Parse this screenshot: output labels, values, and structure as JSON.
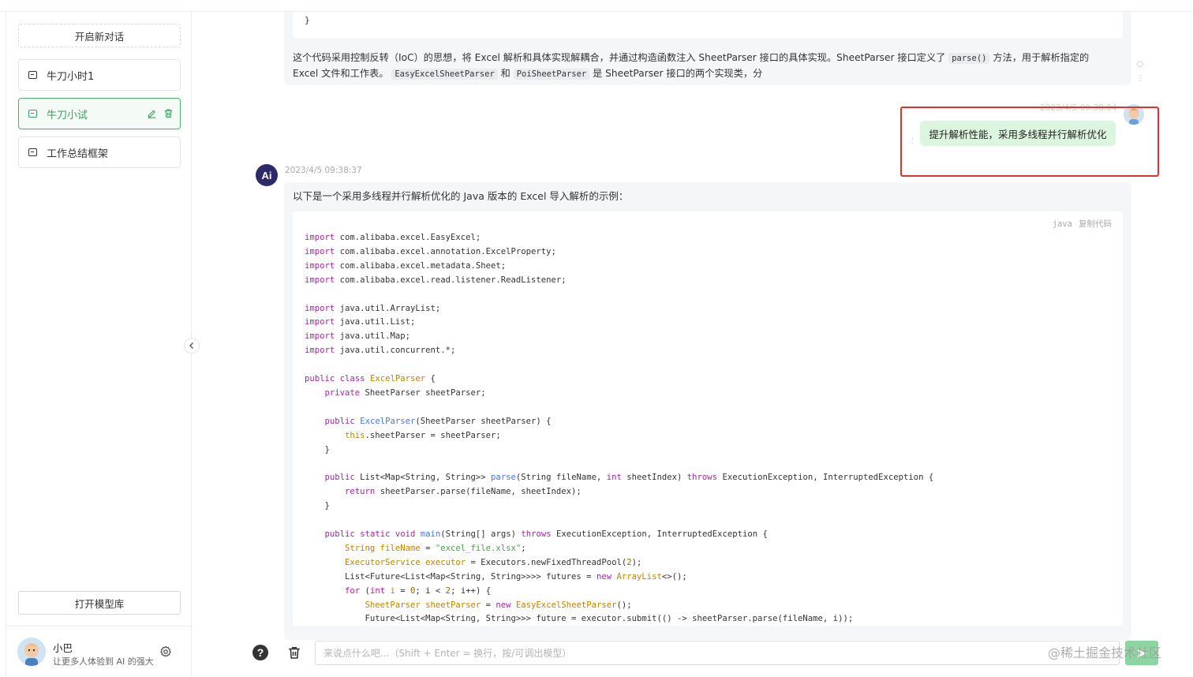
{
  "sidebar": {
    "new_chat_label": "开启新对话",
    "conversations": [
      {
        "label": "牛刀小时1"
      },
      {
        "label": "牛刀小试"
      },
      {
        "label": "工作总结框架"
      }
    ],
    "model_library_label": "打开模型库",
    "user": {
      "name": "小巴",
      "description": "让更多人体验到 AI 的强大"
    }
  },
  "chat": {
    "previous_code_tail": "}",
    "previous_paragraph": {
      "part1": "这个代码采用控制反转（IoC）的思想，将 Excel 解析和具体实现解耦合，并通过构造函数注入 SheetParser 接口的具体实现。SheetParser 接口定义了",
      "code1": "parse()",
      "part2": "方法，用于解析指定的 Excel 文件和工作表。",
      "code2": "EasyExcelSheetParser",
      "part3": "和",
      "code3": "PoiSheetParser",
      "part4": "是 SheetParser 接口的两个实现类，分"
    },
    "user_message": {
      "time": "2023/4/5 09:38:04",
      "text": "提升解析性能，采用多线程并行解析优化"
    },
    "ai_message": {
      "avatar_text": "Ai",
      "time": "2023/4/5 09:38:37",
      "intro": "以下是一个采用多线程并行解析优化的 Java 版本的 Excel 导入解析的示例：",
      "code_lang": "java",
      "copy_label": "复制代码"
    }
  },
  "input": {
    "placeholder": "来说点什么吧...（Shift + Enter = 换行，按/可调出模型）"
  },
  "watermark": "@稀土掘金技术社区",
  "colors": {
    "accent": "#3e9d5d",
    "highlight_box": "#e2322b",
    "user_bubble": "#dcf5de",
    "send_button": "#8cd4a0"
  }
}
